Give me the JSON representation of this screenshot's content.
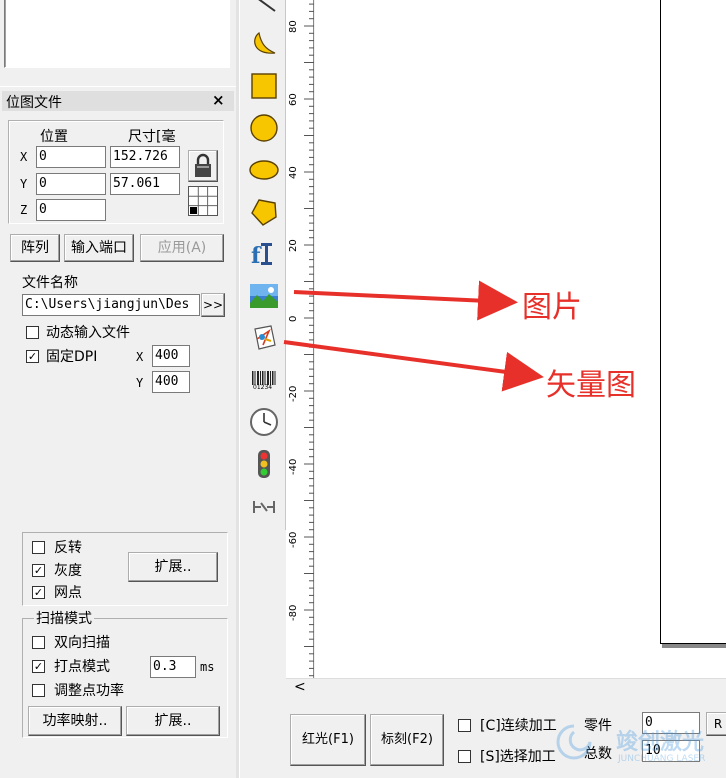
{
  "bitmap_panel": {
    "title": "位图文件",
    "close": "×",
    "col_position": "位置",
    "col_size": "尺寸[毫",
    "x_label": "X",
    "y_label": "Y",
    "z_label": "Z",
    "x_value": "0",
    "y_value": "0",
    "z_value": "0",
    "width_value": "152.726",
    "height_value": "57.061",
    "array_button": "阵列",
    "input_port_button": "输入端口",
    "apply_button": "应用(A)",
    "file_name_label": "文件名称",
    "file_path": "C:\\Users\\jiangjun\\Des",
    "browse_button": ">>",
    "dynamic_input_label": "动态输入文件",
    "dynamic_input_checked": false,
    "fixed_dpi_label": "固定DPI",
    "fixed_dpi_checked": true,
    "dpi_x_label": "X",
    "dpi_x_value": "400",
    "dpi_y_label": "Y",
    "dpi_y_value": "400",
    "invert_label": "反转",
    "invert_checked": false,
    "grayscale_label": "灰度",
    "grayscale_checked": true,
    "dither_label": "网点",
    "dither_checked": true,
    "extend_button_1": "扩展..",
    "scan_mode_label": "扫描模式",
    "bidirectional_label": "双向扫描",
    "bidirectional_checked": false,
    "dot_mode_label": "打点模式",
    "dot_mode_checked": true,
    "dot_mode_value": "0.3",
    "dot_mode_unit": "ms",
    "adjust_power_label": "调整点功率",
    "adjust_power_checked": false,
    "power_map_button": "功率映射..",
    "extend_button_2": "扩展.."
  },
  "toolbar": {
    "tools": [
      "curve-tool",
      "ellipse-arc-tool",
      "rectangle-tool",
      "circle-tool",
      "ellipse-tool",
      "polygon-tool",
      "text-tool",
      "image-tool",
      "vector-import-tool",
      "barcode-tool",
      "clock-tool",
      "traffic-light-tool",
      "extend-axis-tool"
    ],
    "barcode_text": "01234"
  },
  "ruler": {
    "labels": [
      "80",
      "60",
      "40",
      "20",
      "0",
      "-20",
      "-40",
      "-60",
      "-80"
    ]
  },
  "annotations": {
    "image_label": "图片",
    "vector_label": "矢量图",
    "arrow_color": "#e8302a"
  },
  "bottom_bar": {
    "red_light_button": "红光(F1)",
    "mark_button": "标刻(F2)",
    "continuous_label": "[C]连续加工",
    "continuous_checked": false,
    "select_label": "[S]选择加工",
    "select_checked": false,
    "parts_label": "零件",
    "parts_value": "0",
    "total_label": "总数",
    "total_value": "10",
    "r_button": "R"
  },
  "scroll": {
    "left_arrow": "<"
  },
  "watermark": {
    "cn": "竣创激光",
    "en": "JUNCHUANG LASER"
  }
}
